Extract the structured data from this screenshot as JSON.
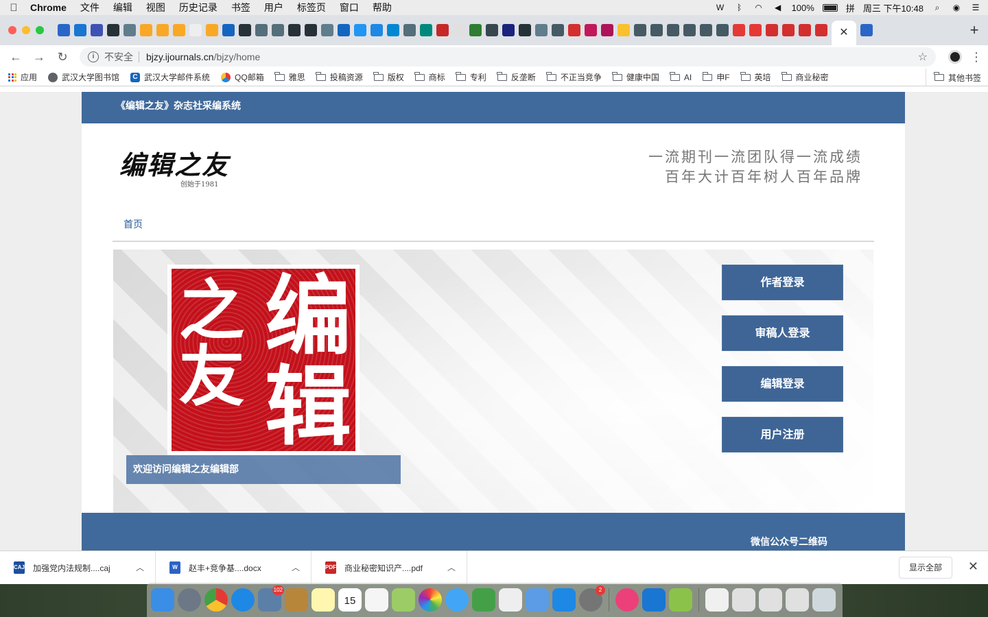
{
  "menubar": {
    "app_name": "Chrome",
    "items": [
      "文件",
      "编辑",
      "视图",
      "历史记录",
      "书签",
      "用户",
      "标签页",
      "窗口",
      "帮助"
    ],
    "battery": "100%",
    "input_method": "拼",
    "datetime": "周三 下午10:48"
  },
  "browser": {
    "tab_count_visible": 52,
    "url": {
      "security_label": "不安全",
      "host": "bjzy.ijournals.cn",
      "path": "/bjzy/home"
    },
    "bookmarks": [
      {
        "label": "应用",
        "icon": "apps-icon"
      },
      {
        "label": "武汉大学图书馆",
        "icon": "globe-icon"
      },
      {
        "label": "武汉大学邮件系统",
        "icon": "c-icon"
      },
      {
        "label": "QQ邮箱",
        "icon": "qq-icon"
      },
      {
        "label": "雅思",
        "icon": "folder-icon"
      },
      {
        "label": "投稿资源",
        "icon": "folder-icon"
      },
      {
        "label": "版权",
        "icon": "folder-icon"
      },
      {
        "label": "商标",
        "icon": "folder-icon"
      },
      {
        "label": "专利",
        "icon": "folder-icon"
      },
      {
        "label": "反垄断",
        "icon": "folder-icon"
      },
      {
        "label": "不正当竞争",
        "icon": "folder-icon"
      },
      {
        "label": "健康中国",
        "icon": "folder-icon"
      },
      {
        "label": "AI",
        "icon": "folder-icon"
      },
      {
        "label": "申F",
        "icon": "folder-icon"
      },
      {
        "label": "英培",
        "icon": "folder-icon"
      },
      {
        "label": "商业秘密",
        "icon": "folder-icon"
      }
    ],
    "other_bookmarks": "其他书签"
  },
  "site": {
    "header_title": "《编辑之友》杂志社采编系统",
    "logo_text": "编辑之友",
    "logo_sub": "创始于1981",
    "slogan_line1": "一流期刊一流团队得一流成绩",
    "slogan_line2": "百年大计百年树人百年品牌",
    "nav_home": "首页",
    "seal_chars": [
      "编",
      "辑",
      "之友"
    ],
    "banner_caption": "欢迎访问编辑之友编辑部",
    "buttons": {
      "author_login": "作者登录",
      "reviewer_login": "审稿人登录",
      "editor_login": "编辑登录",
      "register": "用户注册"
    },
    "footer_wechat": "微信公众号二维码"
  },
  "downloads": {
    "items": [
      {
        "name": "加强党内法规制....caj",
        "type": "caj"
      },
      {
        "name": "赵丰+竞争基....docx",
        "type": "docx"
      },
      {
        "name": "商业秘密知识产....pdf",
        "type": "pdf"
      }
    ],
    "show_all": "显示全部"
  },
  "dock": {
    "mail_badge": "102",
    "settings_badge": "2",
    "calendar_day": "15"
  },
  "colors": {
    "site_blue": "#406a9c",
    "button_blue": "#3e6596",
    "seal_red": "#c3101a"
  }
}
